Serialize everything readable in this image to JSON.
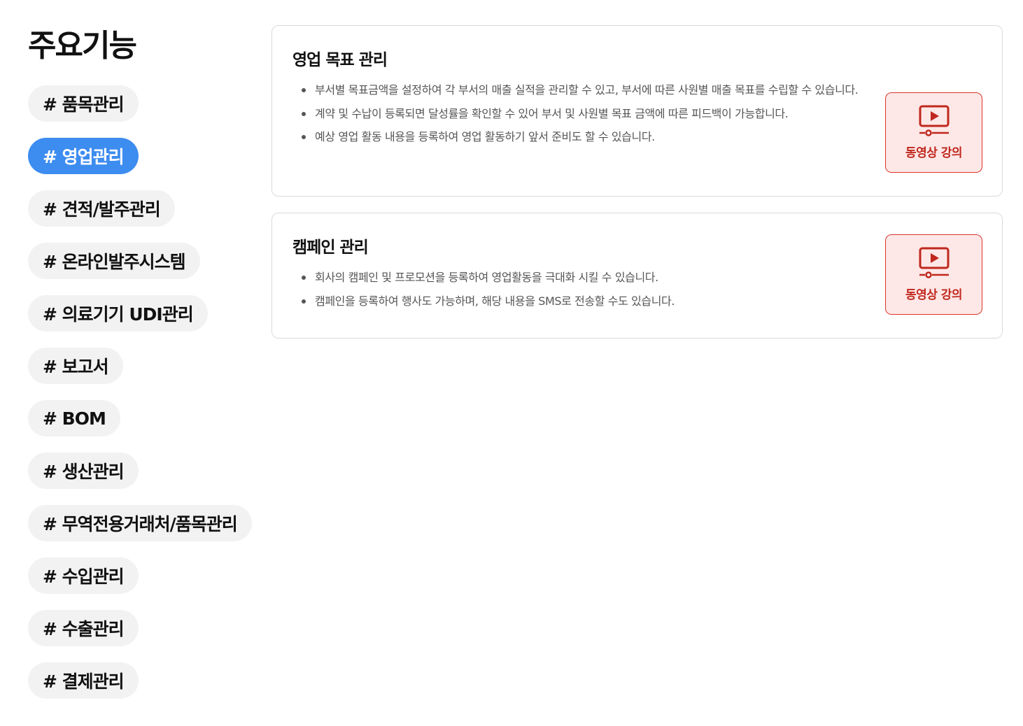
{
  "sidebar": {
    "title": "주요기능",
    "tags": [
      {
        "label": "# 품목관리",
        "active": false
      },
      {
        "label": "# 영업관리",
        "active": true
      },
      {
        "label": "# 견적/발주관리",
        "active": false
      },
      {
        "label": "# 온라인발주시스템",
        "active": false
      },
      {
        "label": "# 의료기기 UDI관리",
        "active": false
      },
      {
        "label": "# 보고서",
        "active": false
      },
      {
        "label": "# BOM",
        "active": false
      },
      {
        "label": "# 생산관리",
        "active": false
      },
      {
        "label": "# 무역전용거래처/품목관리",
        "active": false
      },
      {
        "label": "# 수입관리",
        "active": false
      },
      {
        "label": "# 수출관리",
        "active": false
      },
      {
        "label": "# 결제관리",
        "active": false
      }
    ]
  },
  "cards": [
    {
      "title": "영업 목표 관리",
      "bullets": [
        "부서별 목표금액을 설정하여 각 부서의 매출 실적을 관리할 수 있고, 부서에 따른 사원별 매출 목표를 수립할 수 있습니다.",
        "계약 및 수납이 등록되면 달성률을 확인할 수 있어 부서 및 사원별 목표 금액에 따른 피드백이 가능합니다.",
        "예상 영업 활동 내용을 등록하여 영업 활동하기 앞서 준비도 할 수 있습니다."
      ],
      "video_label": "동영상 강의"
    },
    {
      "title": "캠페인 관리",
      "bullets": [
        "회사의 캠페인 및 프로모션을 등록하여 영업활동을 극대화 시킬 수 있습니다.",
        "캠페인을 등록하여 행사도 가능하며, 해당 내용을 SMS로 전송할 수도 있습니다."
      ],
      "video_label": "동영상 강의"
    }
  ],
  "icons": {
    "video": "video-lecture-icon"
  },
  "colors": {
    "active_tag": "#3d8cf0",
    "tag_bg": "#f2f2f2",
    "video_border": "#d9342b",
    "video_bg": "#fde8e7"
  }
}
